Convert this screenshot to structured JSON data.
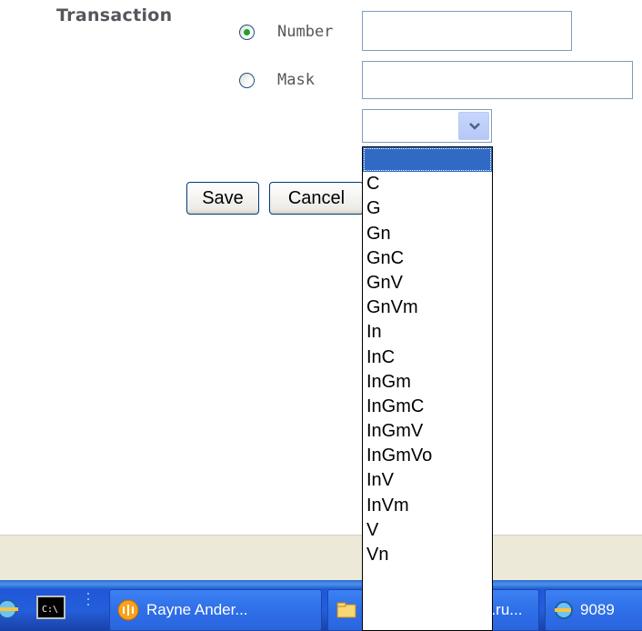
{
  "form": {
    "section_label": "Transaction",
    "radio_number_label": "Number",
    "radio_mask_label": "Mask",
    "radio_selected": "Number",
    "number_value": "",
    "mask_value": "",
    "select_value": ""
  },
  "buttons": {
    "save_label": "Save",
    "cancel_label": "Cancel"
  },
  "dropdown": {
    "options": [
      "",
      "C",
      "G",
      "Gn",
      "GnC",
      "GnV",
      "GnVm",
      "In",
      "InC",
      "InGm",
      "InGmC",
      "InGmV",
      "InGmVo",
      "InV",
      "InVm",
      "V",
      "Vn"
    ],
    "selected_index": 0
  },
  "taskbar": {
    "items": [
      {
        "icon": "ie-icon",
        "label": ""
      },
      {
        "icon": "cmd-icon",
        "label": ""
      },
      {
        "icon": "messenger-icon",
        "label": "Rayne Ander..."
      },
      {
        "icon": "folder-icon",
        "label": "...ru..."
      },
      {
        "icon": "ie-icon",
        "label": "9089"
      }
    ]
  },
  "colors": {
    "selection_blue": "#316ac5",
    "taskbar_blue": "#245edb",
    "radio_dot_green": "#21a121",
    "label_gray": "#55565c"
  }
}
